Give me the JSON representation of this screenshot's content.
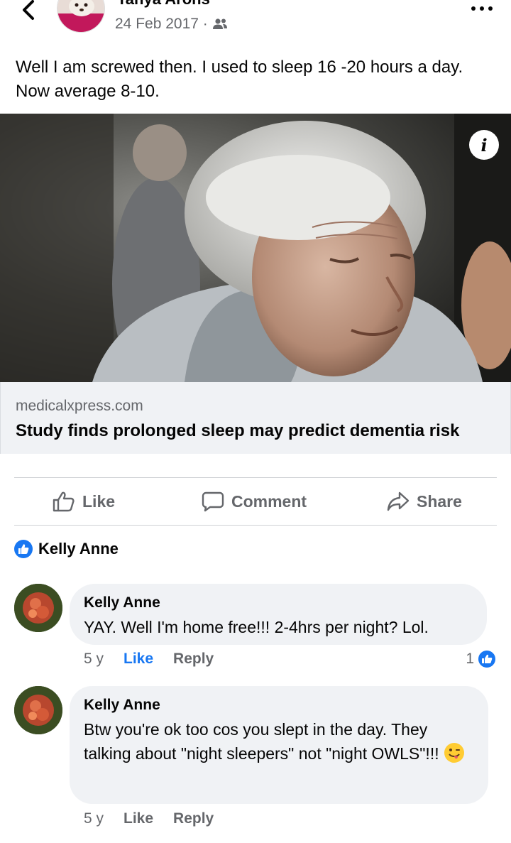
{
  "post": {
    "author": "Tanya Arons",
    "date": "24 Feb 2017 ·",
    "privacy_icon": "friends-icon",
    "text": "Well I am screwed then.  I used to sleep 16 -20 hours a day.  Now average 8-10."
  },
  "link": {
    "domain": "medicalxpress.com",
    "title": "Study finds prolonged sleep may predict dementia risk",
    "info_icon": "i"
  },
  "actions": {
    "like": "Like",
    "comment": "Comment",
    "share": "Share"
  },
  "reactions": {
    "names": "Kelly Anne"
  },
  "comments": [
    {
      "author": "Kelly Anne",
      "text": "YAY. Well I'm home free!!! 2-4hrs per night? Lol.",
      "time": "5 y",
      "like": "Like",
      "reply": "Reply",
      "like_count": "1"
    },
    {
      "author": "Kelly Anne",
      "text": "Btw you're ok too cos you slept in the day. They talking about \"night sleepers\" not \"night OWLS\"!!!",
      "time": "5 y",
      "like": "Like",
      "reply": "Reply"
    }
  ],
  "colors": {
    "accent": "#1877f2",
    "secondary_text": "#65676b",
    "bubble_bg": "#f0f2f5"
  }
}
